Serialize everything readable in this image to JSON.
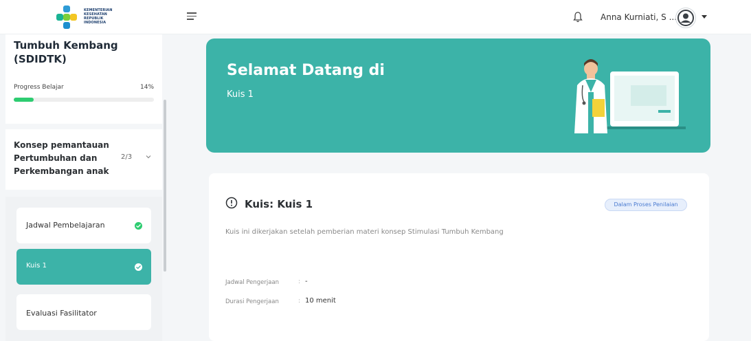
{
  "header": {
    "logo_text": [
      "KEMENTERIAN",
      "KESEHATAN",
      "REPUBLIK",
      "INDONESIA"
    ],
    "menu_icon": "hamburger-icon",
    "notification_icon": "bell-icon",
    "user_name": "Anna Kurniati, S ...",
    "avatar_icon": "user-avatar-icon",
    "dropdown_icon": "caret-down-icon"
  },
  "sidebar": {
    "course_title": "Tumbuh Kembang (SDIDTK)",
    "progress_label": "Progress Belajar",
    "progress_text": "14%",
    "progress_value": 0.14,
    "section": {
      "title": "Konsep pemantauan Pertumbuhan dan Perkembangan anak",
      "count": "2/3"
    },
    "items": [
      {
        "label": "Jadwal Pembelajaran",
        "completed": true,
        "active": false
      },
      {
        "label": "Kuis 1",
        "completed": true,
        "active": true
      },
      {
        "label": "Evaluasi Fasilitator",
        "completed": false,
        "active": false
      }
    ]
  },
  "hero": {
    "title": "Selamat Datang di",
    "subtitle": "Kuis 1"
  },
  "quiz": {
    "title": "Kuis: Kuis 1",
    "status": "Dalam Proses Penilaian",
    "description": "Kuis ini dikerjakan setelah pemberian materi konsep Stimulasi Tumbuh Kembang",
    "schedule_label": "Jadwal Pengerjaan",
    "schedule_value": "-",
    "duration_label": "Durasi Pengerjaan",
    "duration_value": "10 menit",
    "separator": ":"
  },
  "colors": {
    "brand": "#3cb3a8",
    "success": "#2ecc71",
    "badge_text": "#4a7bd0"
  }
}
